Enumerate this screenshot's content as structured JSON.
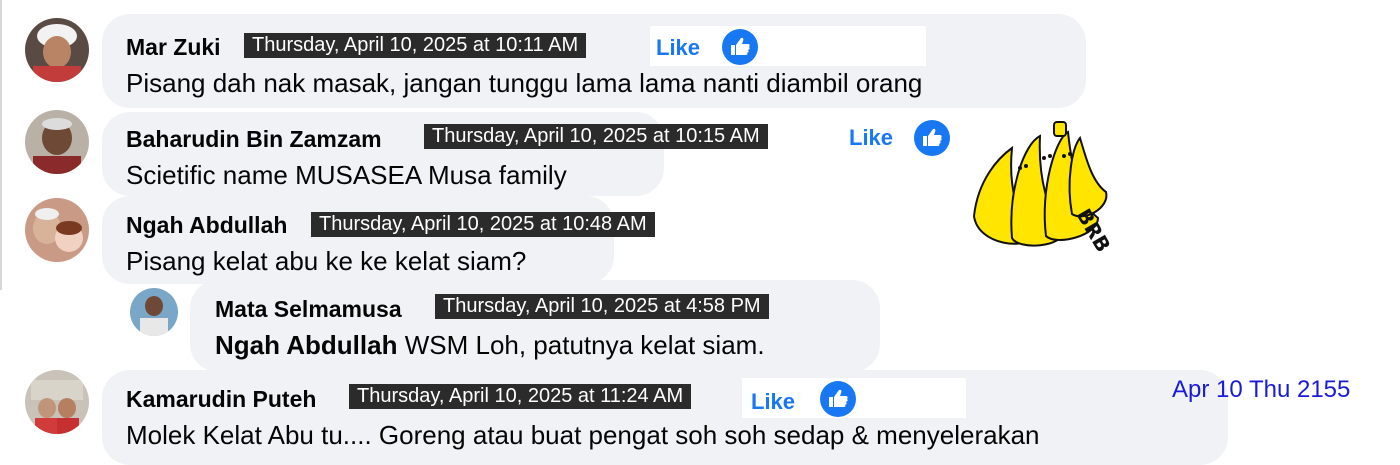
{
  "comments": [
    {
      "author": "Mar Zuki",
      "timestamp": "Thursday, April 10, 2025 at 10:11 AM",
      "text": "Pisang dah nak masak, jangan tunggu lama lama nanti diambil orang",
      "like_label": "Like"
    },
    {
      "author": "Baharudin Bin Zamzam",
      "timestamp": "Thursday, April 10, 2025 at 10:15 AM",
      "text": "Scietific name MUSASEA Musa family",
      "like_label": "Like"
    },
    {
      "author": "Ngah Abdullah",
      "timestamp": "Thursday, April 10, 2025 at 10:48 AM",
      "text": "Pisang kelat abu ke ke kelat siam?"
    },
    {
      "author": "Mata Selmamusa",
      "timestamp": "Thursday, April 10, 2025 at 4:58 PM",
      "mention": "Ngah Abdullah",
      "text": "WSM Loh, patutnya kelat siam."
    },
    {
      "author": "Kamarudin Puteh",
      "timestamp": "Thursday, April 10, 2025 at 11:24 AM",
      "text": "Molek Kelat Abu tu.... Goreng atau buat pengat soh soh sedap & menyelerakan",
      "like_label": "Like"
    }
  ],
  "sticker": {
    "text": "BRB",
    "icon": "banana-brb-sticker"
  },
  "corner_stamp": "Apr 10 Thu 2155",
  "colors": {
    "bubble": "#f0f2f5",
    "like_blue": "#1877f2",
    "timestamp_bg": "#2b2b2b",
    "stamp_blue": "#1a1adb",
    "sticker_yellow": "#ffe500"
  }
}
